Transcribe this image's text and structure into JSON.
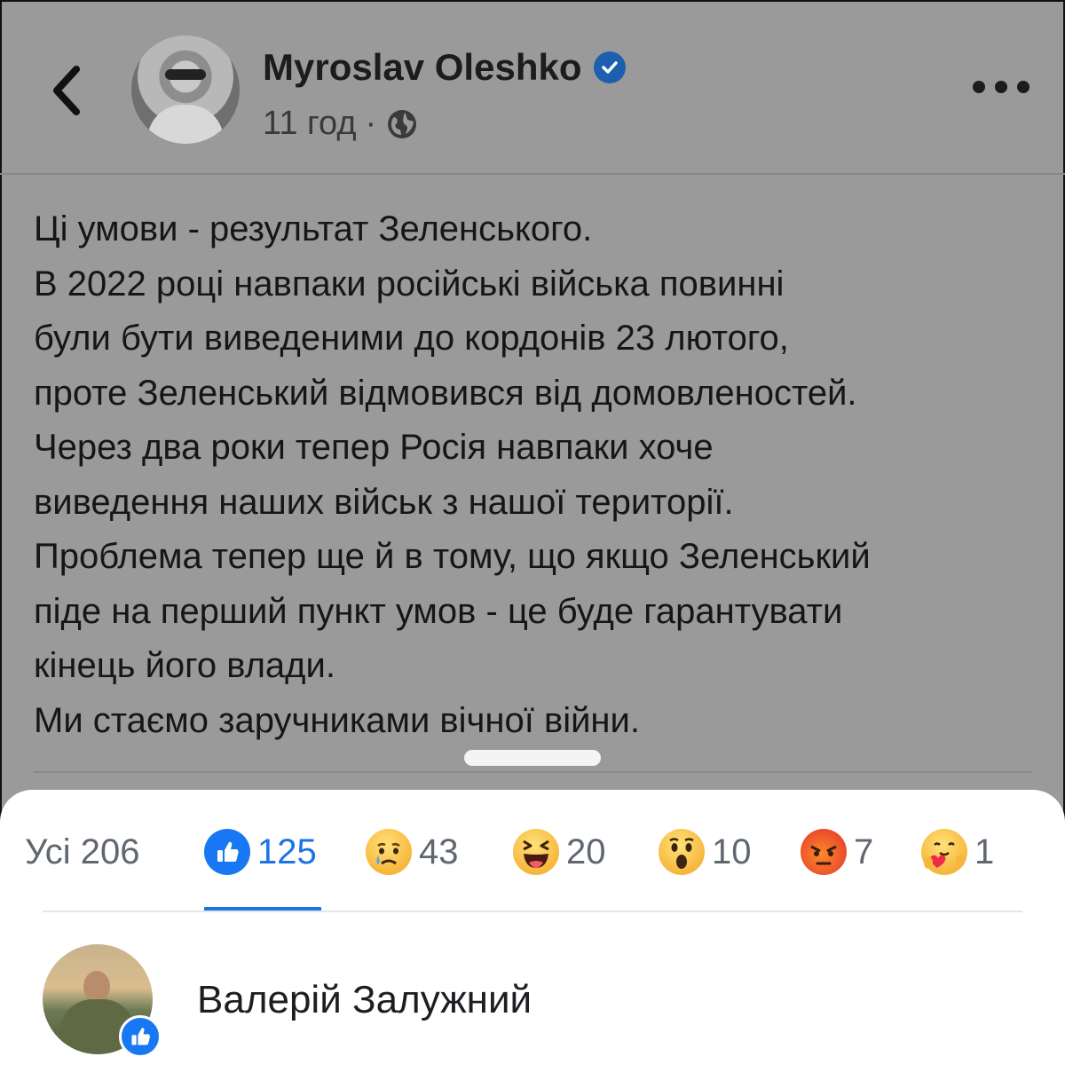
{
  "header": {
    "author_name": "Myroslav Oleshko",
    "time": "11 год",
    "separator": "·",
    "icons": {
      "back": "chevron-left-icon",
      "verified": "verified-badge-icon",
      "privacy": "globe-icon",
      "more": "more-horizontal-icon"
    }
  },
  "post": {
    "lines": [
      "Ці умови - результат Зеленського.",
      "В 2022 році навпаки російські війська повинні",
      "були бути виведеними до кордонів 23 лютого,",
      "проте Зеленський відмовився від домовленостей.",
      "Через два роки тепер Росія навпаки хоче",
      "виведення наших військ з нашої території.",
      "Проблема тепер ще й в тому, що якщо Зеленський",
      "піде на перший пункт умов - це буде гарантувати",
      "кінець його влади.",
      "Ми стаємо заручниками вічної війни."
    ]
  },
  "reactions": {
    "tabs": [
      {
        "label": "Усі 206"
      },
      {
        "icon": "like-reaction-icon",
        "count": "125"
      },
      {
        "icon": "sad-reaction-icon",
        "count": "43"
      },
      {
        "icon": "haha-reaction-icon",
        "count": "20"
      },
      {
        "icon": "wow-reaction-icon",
        "count": "10"
      },
      {
        "icon": "angry-reaction-icon",
        "count": "7"
      },
      {
        "icon": "care-reaction-icon",
        "count": "1"
      }
    ],
    "active_tab": 1,
    "colors": {
      "accent": "#1b74e4",
      "like": "#1877f2"
    },
    "reactors": [
      {
        "name": "Валерій Залужний",
        "reaction": "like-reaction-icon"
      }
    ]
  }
}
